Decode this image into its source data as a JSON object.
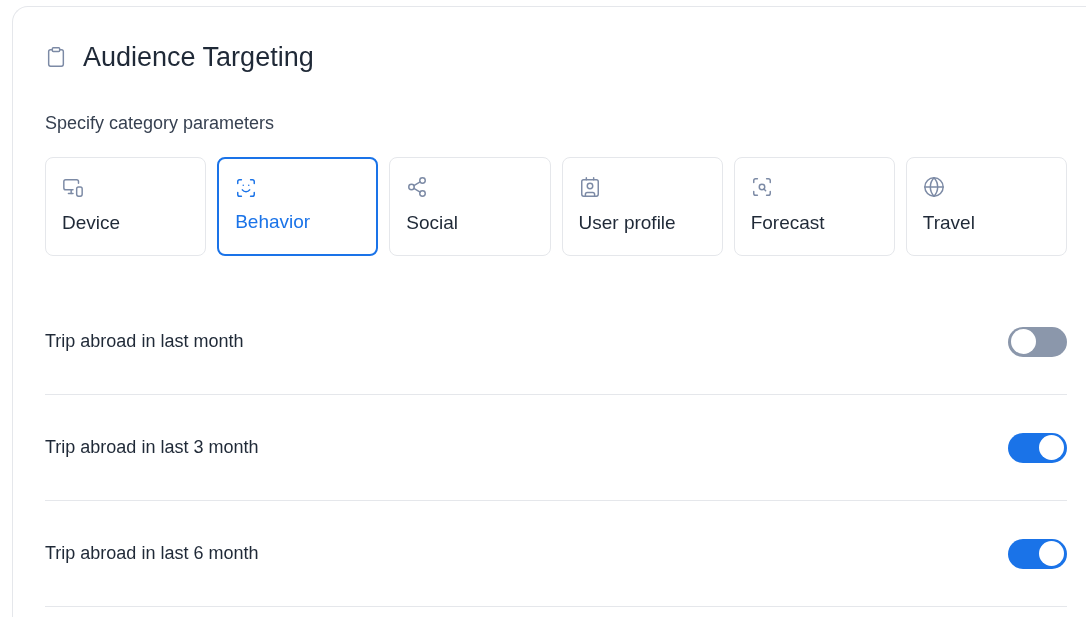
{
  "title": "Audience Targeting",
  "subtitle": "Specify category parameters",
  "categories": [
    {
      "label": "Device",
      "kind": "device",
      "selected": false
    },
    {
      "label": "Behavior",
      "kind": "behavior",
      "selected": true
    },
    {
      "label": "Social",
      "kind": "social",
      "selected": false
    },
    {
      "label": "User profile",
      "kind": "profile",
      "selected": false
    },
    {
      "label": "Forecast",
      "kind": "forecast",
      "selected": false
    },
    {
      "label": "Travel",
      "kind": "travel",
      "selected": false
    }
  ],
  "options": [
    {
      "label": "Trip abroad in last month",
      "on": false
    },
    {
      "label": "Trip abroad in last 3 month",
      "on": true
    },
    {
      "label": "Trip abroad in last 6 month",
      "on": true
    }
  ]
}
